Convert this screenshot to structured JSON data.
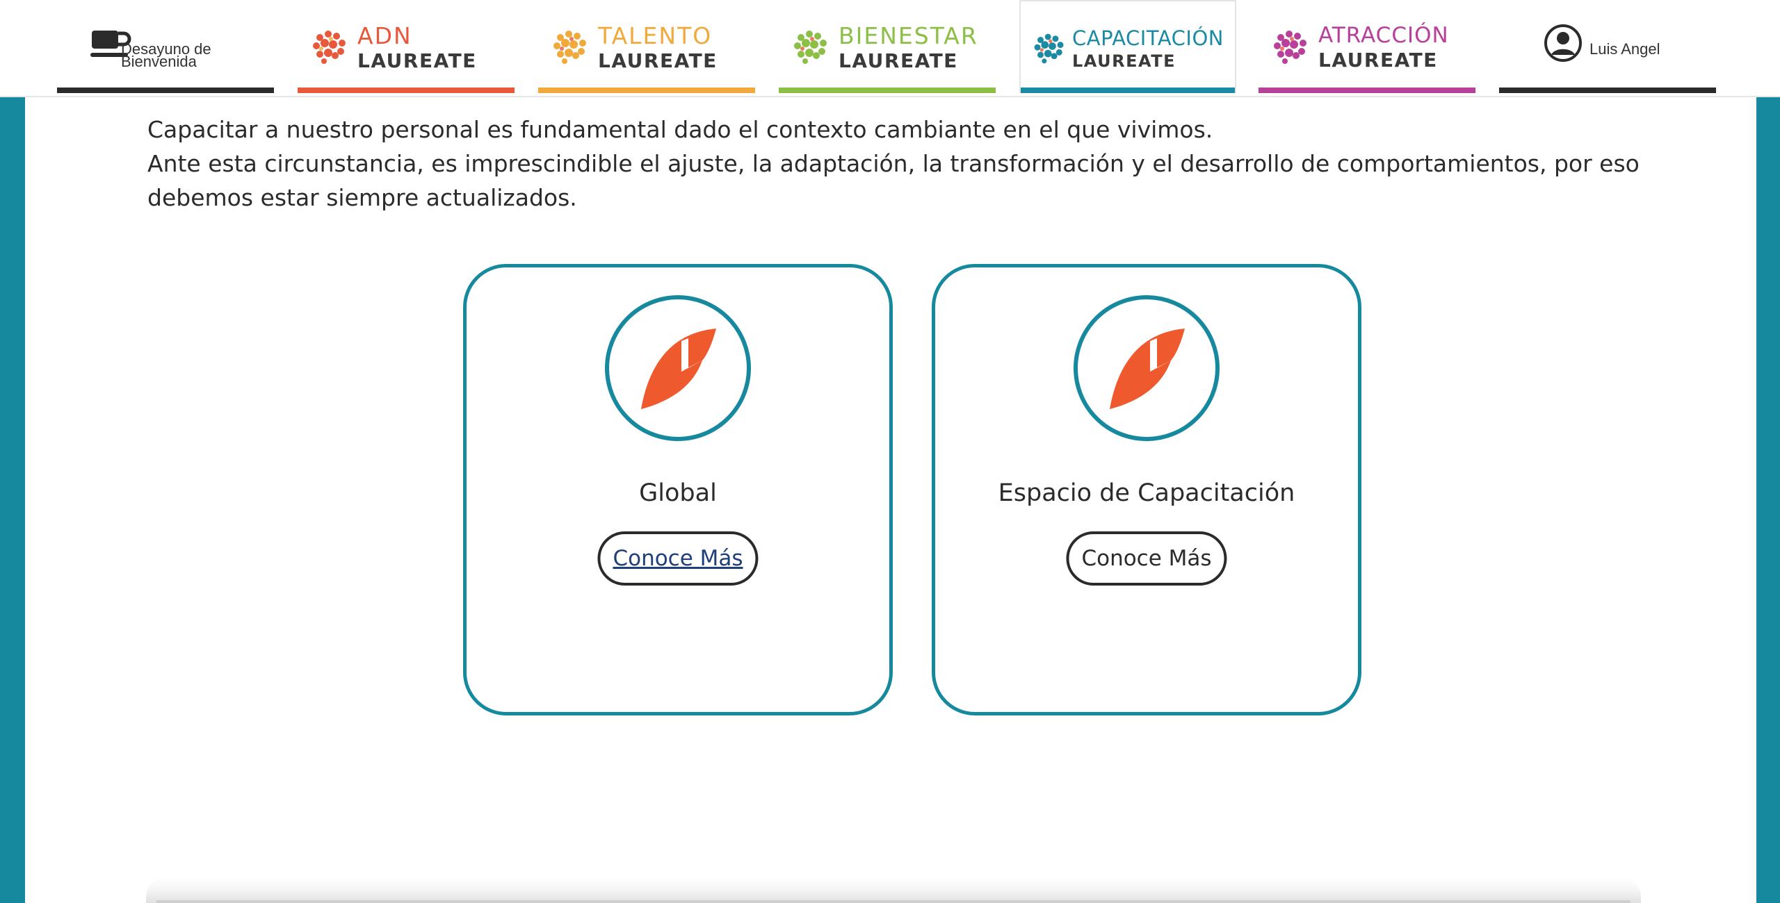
{
  "nav": {
    "breakfast": {
      "label": "Desayuno de Bienvenida",
      "icon": "coffee-cup-icon",
      "color": "#2b2b2b"
    },
    "items": [
      {
        "word": "ADN",
        "sub": "LAUREATE",
        "color": "#e8583a",
        "icon": "brain-icon"
      },
      {
        "word": "TALENTO",
        "sub": "LAUREATE",
        "color": "#f2a93b",
        "icon": "brain-icon"
      },
      {
        "word": "BIENESTAR",
        "sub": "LAUREATE",
        "color": "#8bbf45",
        "icon": "brain-icon"
      },
      {
        "word": "CAPACITACIÓN",
        "sub": "LAUREATE",
        "color": "#1b8aa3",
        "icon": "brain-icon",
        "active": true
      },
      {
        "word": "ATRACCIÓN",
        "sub": "LAUREATE",
        "color": "#b8409a",
        "icon": "brain-icon"
      }
    ],
    "user": {
      "name": "Luis Angel",
      "icon": "user-avatar-icon",
      "color": "#2b2b2b"
    }
  },
  "intro": {
    "line1": "Capacitar a nuestro personal es fundamental dado el contexto cambiante en el que vivimos.",
    "line2": "Ante esta circunstancia, es imprescindible el ajuste, la adaptación, la transformación y el desarrollo de comportamientos, por eso debemos estar siempre actualizados."
  },
  "cards": [
    {
      "title": "Global",
      "button": "Conoce Más",
      "icon": "laureate-leaf-icon"
    },
    {
      "title": "Espacio de Capacitación",
      "button": "Conoce Más",
      "icon": "laureate-leaf-icon"
    }
  ],
  "colors": {
    "teal": "#16899e",
    "leaf": "#ee5a2e",
    "text": "#2b2b2b"
  }
}
